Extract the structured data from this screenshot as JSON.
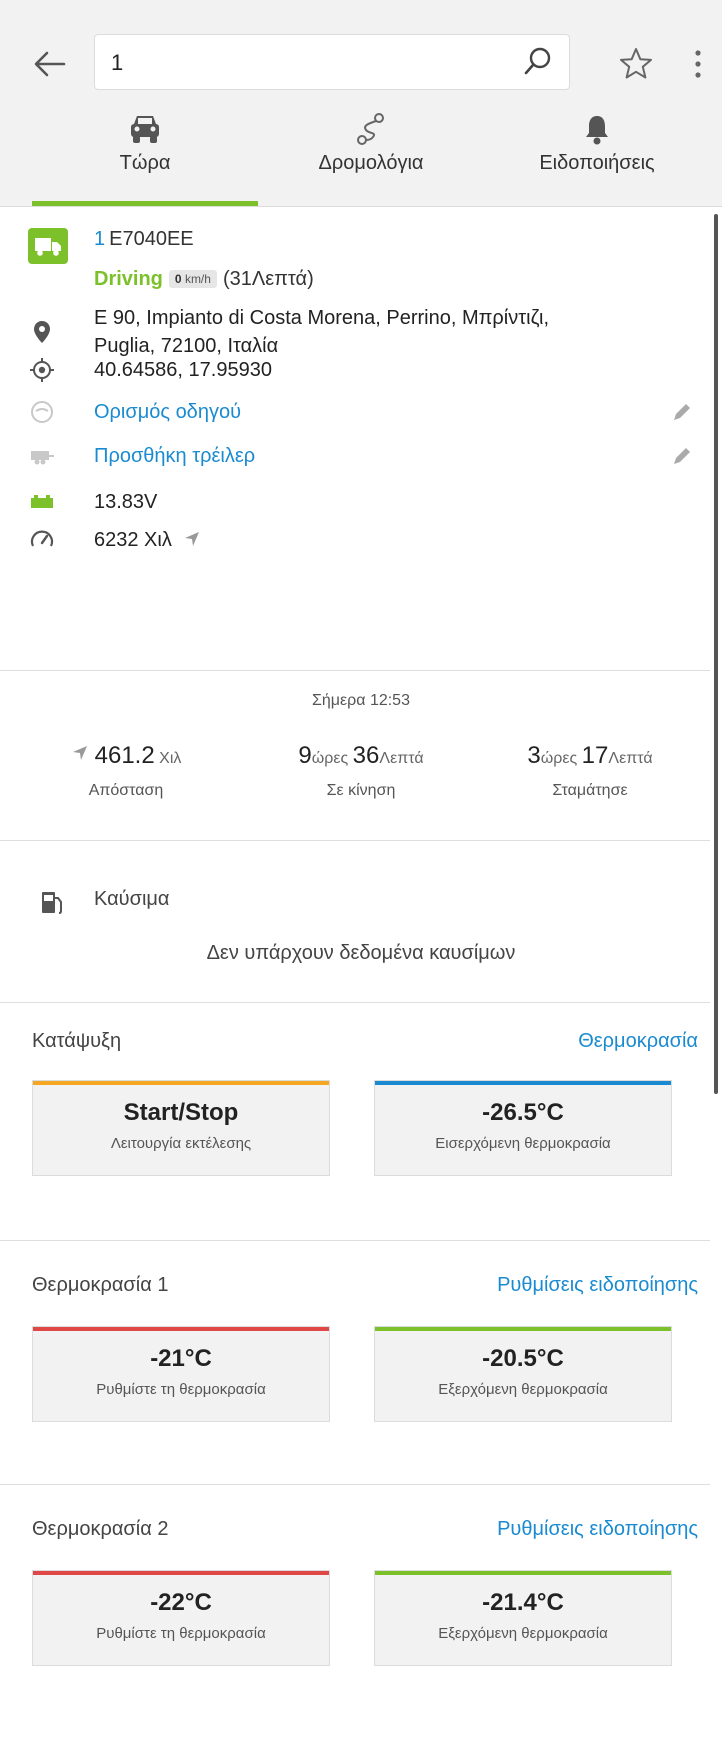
{
  "search": {
    "value": "1"
  },
  "tabs": [
    {
      "label": "Τώρα",
      "active": true
    },
    {
      "label": "Δρομολόγια",
      "active": false
    },
    {
      "label": "Ειδοποιήσεις",
      "active": false
    }
  ],
  "vehicle": {
    "number": "1",
    "plate": "E7040EE",
    "status": "Driving",
    "speed_value": "0",
    "speed_unit": "km/h",
    "duration": "(31Λεπτά)",
    "address_line1": "E 90, Impianto di Costa Morena, Perrino, Μπρίντιζι,",
    "address_line2": "Puglia, 72100, Ιταλία",
    "coordinates": "40.64586, 17.95930",
    "driver_link": "Ορισμός οδηγού",
    "trailer_link": "Προσθήκη τρέιλερ",
    "voltage": "13.83V",
    "odometer": "6232 Χιλ"
  },
  "stats": {
    "date": "Σήμερα 12:53",
    "distance": {
      "value": "461.2",
      "unit": "Χιλ",
      "caption": "Απόσταση"
    },
    "moving": {
      "h": "9",
      "h_unit": "ώρες",
      "m": "36",
      "m_unit": "Λεπτά",
      "caption": "Σε κίνηση"
    },
    "stopped": {
      "h": "3",
      "h_unit": "ώρες",
      "m": "17",
      "m_unit": "Λεπτά",
      "caption": "Σταμάτησε"
    }
  },
  "fuel": {
    "title": "Καύσιμα",
    "empty": "Δεν υπάρχουν δεδομένα καυσίμων"
  },
  "freezer": {
    "title": "Κατάψυξη",
    "link": "Θερμοκρασία",
    "cards": [
      {
        "value": "Start/Stop",
        "caption": "Λειτουργία εκτέλεσης",
        "color": "#f5a623"
      },
      {
        "value": "-26.5°C",
        "caption": "Εισερχόμενη θερμοκρασία",
        "color": "#1a8bd0"
      }
    ]
  },
  "temp1": {
    "title": "Θερμοκρασία 1",
    "link": "Ρυθμίσεις ειδοποίησης",
    "cards": [
      {
        "value": "-21°C",
        "caption": "Ρυθμίστε τη θερμοκρασία",
        "color": "#e04848"
      },
      {
        "value": "-20.5°C",
        "caption": "Εξερχόμενη θερμοκρασία",
        "color": "#7cc12a"
      }
    ]
  },
  "temp2": {
    "title": "Θερμοκρασία 2",
    "link": "Ρυθμίσεις ειδοποίησης",
    "cards": [
      {
        "value": "-22°C",
        "caption": "Ρυθμίστε τη θερμοκρασία",
        "color": "#e04848"
      },
      {
        "value": "-21.4°C",
        "caption": "Εξερχόμενη θερμοκρασία",
        "color": "#7cc12a"
      }
    ]
  },
  "colors": {
    "accent_green": "#7cc12a",
    "link_blue": "#1a8bd0"
  },
  "icons": [
    "back-arrow-icon",
    "search-icon",
    "star-icon",
    "more-vertical-icon",
    "car-icon",
    "route-icon",
    "bell-icon",
    "truck-icon",
    "location-pin-icon",
    "crosshair-icon",
    "driver-icon",
    "trailer-icon",
    "battery-icon",
    "speedometer-icon",
    "navigation-arrow-icon",
    "fuel-pump-icon",
    "edit-pencil-icon"
  ]
}
